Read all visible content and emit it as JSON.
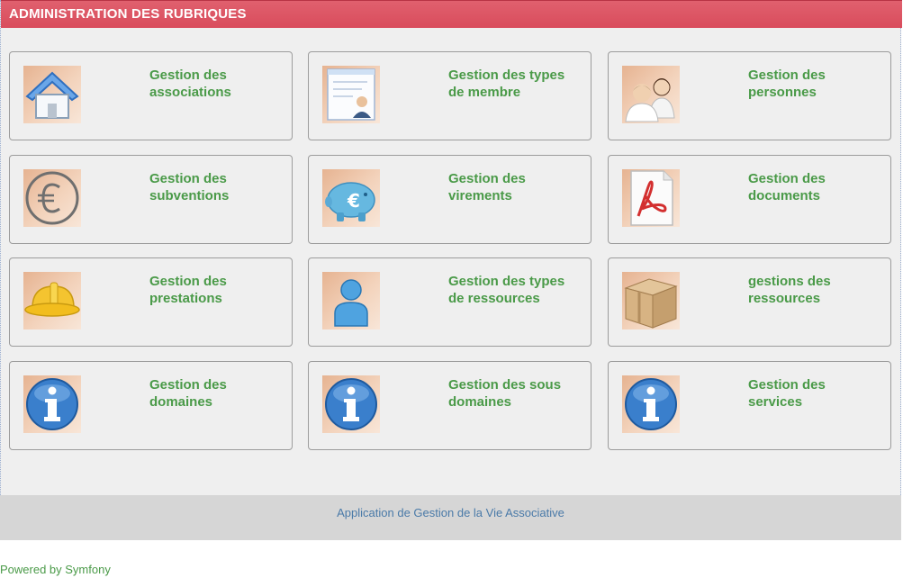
{
  "header": {
    "title": "ADMINISTRATION DES RUBRIQUES"
  },
  "tiles": [
    {
      "label": "Gestion des associations",
      "icon": "home-icon"
    },
    {
      "label": "Gestion des types de membre",
      "icon": "member-card-icon"
    },
    {
      "label": "Gestion des personnes",
      "icon": "people-icon"
    },
    {
      "label": "Gestion des subventions",
      "icon": "euro-icon"
    },
    {
      "label": "Gestion des virements",
      "icon": "piggy-bank-icon"
    },
    {
      "label": "Gestion des documents",
      "icon": "pdf-document-icon"
    },
    {
      "label": "Gestion des prestations",
      "icon": "hard-hat-icon"
    },
    {
      "label": "Gestion des types de ressources",
      "icon": "user-icon"
    },
    {
      "label": "gestions des ressources",
      "icon": "box-icon"
    },
    {
      "label": "Gestion des domaines",
      "icon": "info-icon"
    },
    {
      "label": "Gestion des sous domaines",
      "icon": "info-icon"
    },
    {
      "label": "Gestion des services",
      "icon": "info-icon"
    }
  ],
  "footer": {
    "text": "Application de Gestion de la Vie Associative"
  },
  "powered_by": "Powered by Symfony",
  "colors": {
    "header_bg": "#dd5565",
    "tile_label": "#4a9a48",
    "footer_text": "#4a7aa8",
    "icon_bg": "#f0c9ad"
  }
}
